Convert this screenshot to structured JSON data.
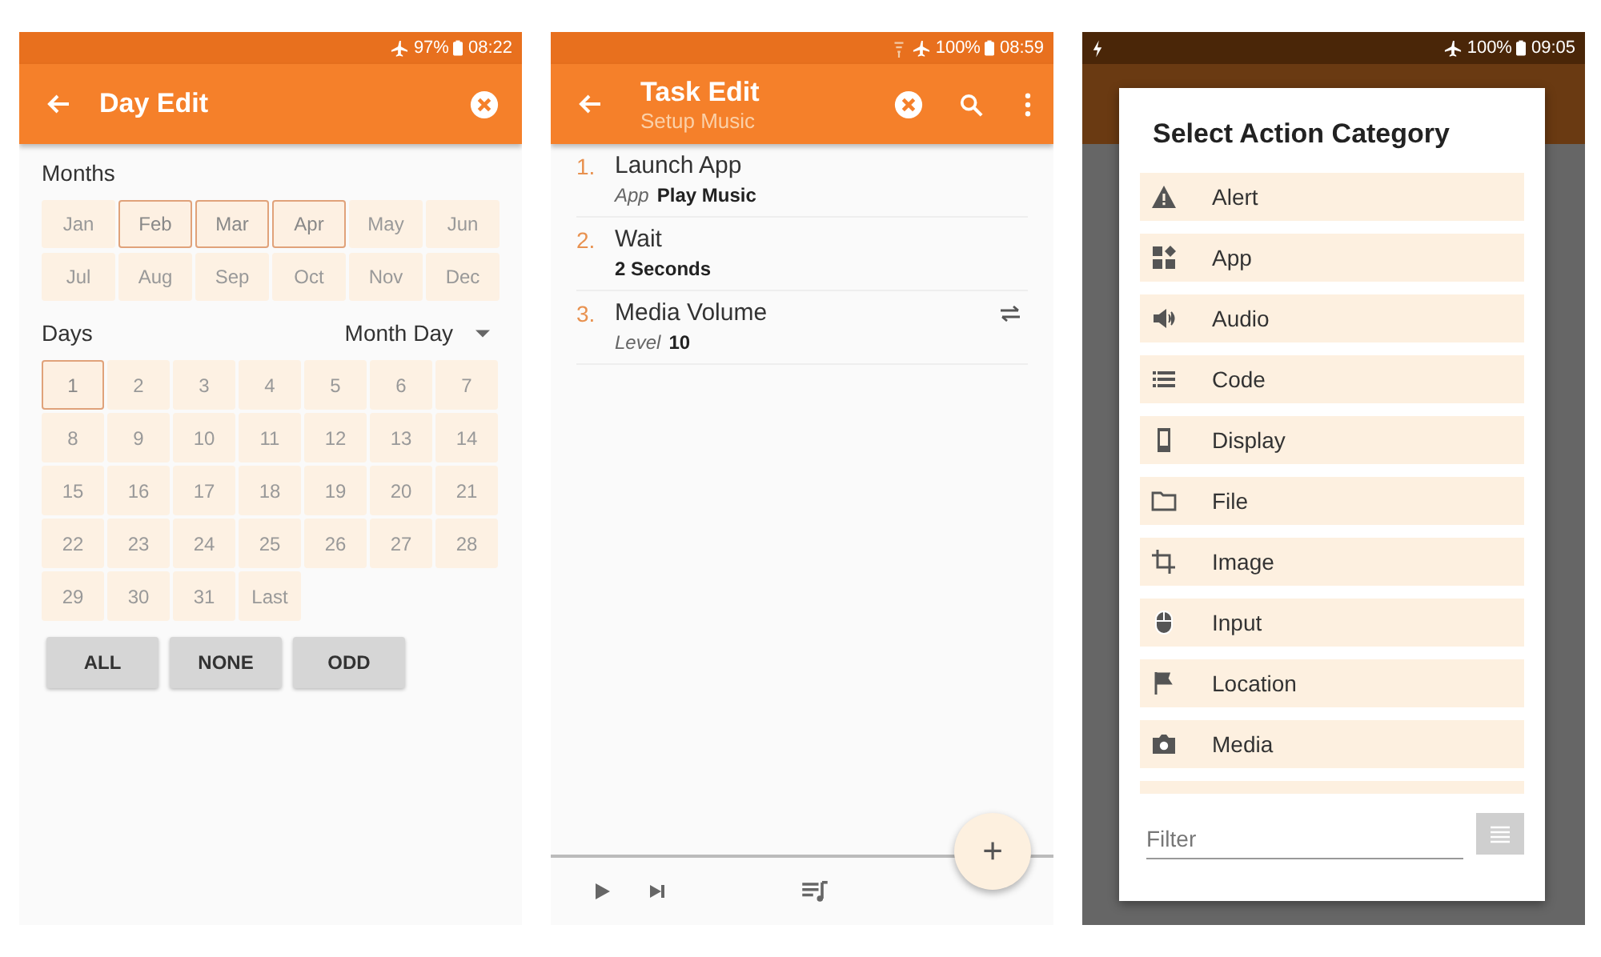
{
  "day_edit": {
    "status_bar": {
      "battery": "97%",
      "time": "08:22"
    },
    "title": "Day Edit",
    "months_label": "Months",
    "months": [
      {
        "label": "Jan",
        "selected": false
      },
      {
        "label": "Feb",
        "selected": true
      },
      {
        "label": "Mar",
        "selected": true
      },
      {
        "label": "Apr",
        "selected": true
      },
      {
        "label": "May",
        "selected": false
      },
      {
        "label": "Jun",
        "selected": false
      },
      {
        "label": "Jul",
        "selected": false
      },
      {
        "label": "Aug",
        "selected": false
      },
      {
        "label": "Sep",
        "selected": false
      },
      {
        "label": "Oct",
        "selected": false
      },
      {
        "label": "Nov",
        "selected": false
      },
      {
        "label": "Dec",
        "selected": false
      }
    ],
    "days_label": "Days",
    "day_mode": "Month Day",
    "days": [
      {
        "label": "1",
        "selected": true
      },
      {
        "label": "2",
        "selected": false
      },
      {
        "label": "3",
        "selected": false
      },
      {
        "label": "4",
        "selected": false
      },
      {
        "label": "5",
        "selected": false
      },
      {
        "label": "6",
        "selected": false
      },
      {
        "label": "7",
        "selected": false
      },
      {
        "label": "8",
        "selected": false
      },
      {
        "label": "9",
        "selected": false
      },
      {
        "label": "10",
        "selected": false
      },
      {
        "label": "11",
        "selected": false
      },
      {
        "label": "12",
        "selected": false
      },
      {
        "label": "13",
        "selected": false
      },
      {
        "label": "14",
        "selected": false
      },
      {
        "label": "15",
        "selected": false
      },
      {
        "label": "16",
        "selected": false
      },
      {
        "label": "17",
        "selected": false
      },
      {
        "label": "18",
        "selected": false
      },
      {
        "label": "19",
        "selected": false
      },
      {
        "label": "20",
        "selected": false
      },
      {
        "label": "21",
        "selected": false
      },
      {
        "label": "22",
        "selected": false
      },
      {
        "label": "23",
        "selected": false
      },
      {
        "label": "24",
        "selected": false
      },
      {
        "label": "25",
        "selected": false
      },
      {
        "label": "26",
        "selected": false
      },
      {
        "label": "27",
        "selected": false
      },
      {
        "label": "28",
        "selected": false
      },
      {
        "label": "29",
        "selected": false
      },
      {
        "label": "30",
        "selected": false
      },
      {
        "label": "31",
        "selected": false
      },
      {
        "label": "Last",
        "selected": false
      }
    ],
    "buttons": [
      "ALL",
      "NONE",
      "ODD"
    ]
  },
  "task_edit": {
    "status_bar": {
      "battery": "100%",
      "time": "08:59"
    },
    "title": "Task Edit",
    "subtitle": "Setup Music",
    "actions": [
      {
        "number": "1.",
        "name": "Launch App",
        "param_label": "App",
        "param_value": "Play Music",
        "swap": false
      },
      {
        "number": "2.",
        "name": "Wait",
        "param_value": "2 Seconds",
        "swap": false
      },
      {
        "number": "3.",
        "name": "Media Volume",
        "param_label": "Level",
        "param_value": "10",
        "swap": true
      }
    ],
    "fab": "+"
  },
  "action_category": {
    "status_bar": {
      "battery": "100%",
      "time": "09:05"
    },
    "title": "Select Action Category",
    "categories": [
      "Alert",
      "App",
      "Audio",
      "Code",
      "Display",
      "File",
      "Image",
      "Input",
      "Location",
      "Media"
    ],
    "filter": {
      "placeholder": "Filter"
    }
  }
}
